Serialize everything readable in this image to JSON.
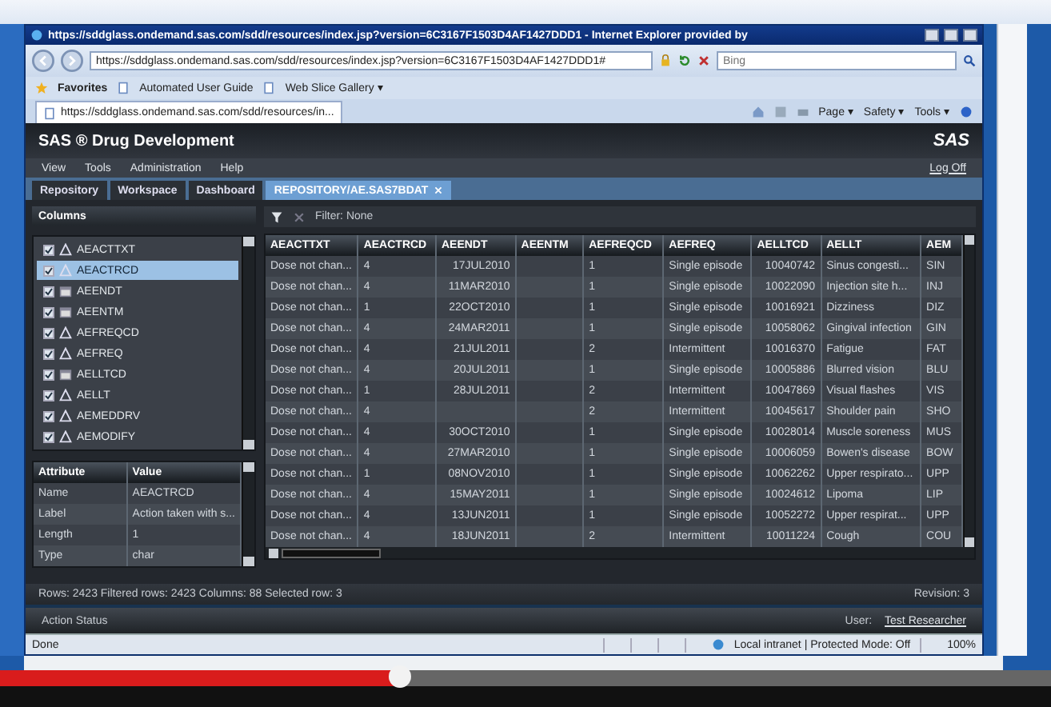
{
  "browser": {
    "title": "https://sddglass.ondemand.sas.com/sdd/resources/index.jsp?version=6C3167F1503D4AF1427DDD1 - Internet Explorer provided by",
    "address": "https://sddglass.ondemand.sas.com/sdd/resources/index.jsp?version=6C3167F1503D4AF1427DDD1#",
    "search": {
      "placeholder": "Bing"
    },
    "favorites": [
      {
        "label": "Favorites",
        "kind": "star"
      },
      {
        "label": "Automated User Guide",
        "kind": "page"
      },
      {
        "label": "Web Slice Gallery ▾",
        "kind": "page"
      }
    ],
    "tab": "https://sddglass.ondemand.sas.com/sdd/resources/in...",
    "commands": [
      "Page ▾",
      "Safety ▾",
      "Tools ▾"
    ],
    "status": "Done",
    "zone": "Local intranet | Protected Mode: Off",
    "zoom": "100%"
  },
  "app": {
    "title": "SAS ® Drug Development",
    "logo": "SAS",
    "menu": [
      "View",
      "Tools",
      "Administration",
      "Help"
    ],
    "logoff": "Log Off",
    "tabs": [
      {
        "label": "Repository",
        "selected": false,
        "closable": false
      },
      {
        "label": "Workspace",
        "selected": false,
        "closable": false
      },
      {
        "label": "Dashboard",
        "selected": false,
        "closable": false
      },
      {
        "label": "REPOSITORY/AE.SAS7BDAT",
        "selected": true,
        "closable": true
      }
    ],
    "columns_panel": {
      "title": "Columns",
      "items": [
        {
          "name": "AEACTTXT",
          "kind": "char",
          "checked": true,
          "selected": false
        },
        {
          "name": "AEACTRCD",
          "kind": "char",
          "checked": true,
          "selected": true
        },
        {
          "name": "AEENDT",
          "kind": "date",
          "checked": true,
          "selected": false
        },
        {
          "name": "AEENTM",
          "kind": "date",
          "checked": true,
          "selected": false
        },
        {
          "name": "AEFREQCD",
          "kind": "char",
          "checked": true,
          "selected": false
        },
        {
          "name": "AEFREQ",
          "kind": "char",
          "checked": true,
          "selected": false
        },
        {
          "name": "AELLTCD",
          "kind": "date",
          "checked": true,
          "selected": false
        },
        {
          "name": "AELLT",
          "kind": "char",
          "checked": true,
          "selected": false
        },
        {
          "name": "AEMEDDRV",
          "kind": "char",
          "checked": true,
          "selected": false
        },
        {
          "name": "AEMODIFY",
          "kind": "char",
          "checked": true,
          "selected": false
        }
      ]
    },
    "attributes": {
      "columns": [
        "Attribute",
        "Value"
      ],
      "rows": [
        [
          "Name",
          "AEACTRCD"
        ],
        [
          "Label",
          "Action taken with s..."
        ],
        [
          "Length",
          "1"
        ],
        [
          "Type",
          "char"
        ]
      ]
    },
    "filter": "Filter: None",
    "grid": {
      "columns": [
        "AEACTTXT",
        "AEACTRCD",
        "AEENDT",
        "AEENTM",
        "AEFREQCD",
        "AEFREQ",
        "AELLTCD",
        "AELLT",
        "AEM"
      ],
      "rows": [
        [
          "Dose not chan...",
          "4",
          "17JUL2010",
          "",
          "1",
          "Single episode",
          "10040742",
          "Sinus congesti...",
          "SIN"
        ],
        [
          "Dose not chan...",
          "4",
          "11MAR2010",
          "",
          "1",
          "Single episode",
          "10022090",
          "Injection site h...",
          "INJ"
        ],
        [
          "Dose not chan...",
          "1",
          "22OCT2010",
          "",
          "1",
          "Single episode",
          "10016921",
          "Dizziness",
          "DIZ"
        ],
        [
          "Dose not chan...",
          "4",
          "24MAR2011",
          "",
          "1",
          "Single episode",
          "10058062",
          "Gingival infection",
          "GIN"
        ],
        [
          "Dose not chan...",
          "4",
          "21JUL2011",
          "",
          "2",
          "Intermittent",
          "10016370",
          "Fatigue",
          "FAT"
        ],
        [
          "Dose not chan...",
          "4",
          "20JUL2011",
          "",
          "1",
          "Single episode",
          "10005886",
          "Blurred vision",
          "BLU"
        ],
        [
          "Dose not chan...",
          "1",
          "28JUL2011",
          "",
          "2",
          "Intermittent",
          "10047869",
          "Visual flashes",
          "VIS"
        ],
        [
          "Dose not chan...",
          "4",
          "",
          "",
          "2",
          "Intermittent",
          "10045617",
          "Shoulder pain",
          "SHO"
        ],
        [
          "Dose not chan...",
          "4",
          "30OCT2010",
          "",
          "1",
          "Single episode",
          "10028014",
          "Muscle soreness",
          "MUS"
        ],
        [
          "Dose not chan...",
          "4",
          "27MAR2010",
          "",
          "1",
          "Single episode",
          "10006059",
          "Bowen's disease",
          "BOW"
        ],
        [
          "Dose not chan...",
          "1",
          "08NOV2010",
          "",
          "1",
          "Single episode",
          "10062262",
          "Upper respirato...",
          "UPP"
        ],
        [
          "Dose not chan...",
          "4",
          "15MAY2011",
          "",
          "1",
          "Single episode",
          "10024612",
          "Lipoma",
          "LIP"
        ],
        [
          "Dose not chan...",
          "4",
          "13JUN2011",
          "",
          "1",
          "Single episode",
          "10052272",
          "Upper respirat...",
          "UPP"
        ],
        [
          "Dose not chan...",
          "4",
          "18JUN2011",
          "",
          "2",
          "Intermittent",
          "10011224",
          "Cough",
          "COU"
        ]
      ]
    },
    "status": "Rows: 2423   Filtered rows: 2423   Columns: 88   Selected row: 3",
    "revision": "Revision: 3",
    "footer": "Action Status",
    "user": "User:",
    "user_name": "Test Researcher"
  },
  "video": {
    "level": 0.38
  }
}
